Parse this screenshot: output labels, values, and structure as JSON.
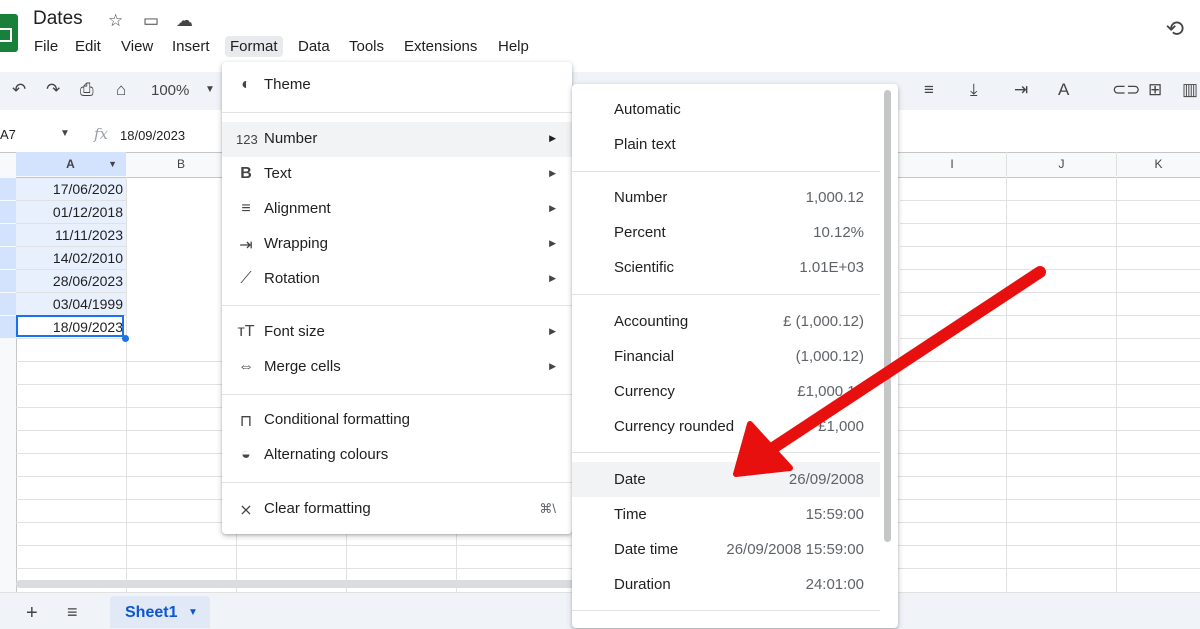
{
  "app": {
    "doc_title": "Dates",
    "menus": [
      "File",
      "Edit",
      "View",
      "Insert",
      "Format",
      "Data",
      "Tools",
      "Extensions",
      "Help"
    ]
  },
  "toolbar": {
    "zoom": "100%"
  },
  "formula_bar": {
    "cell_ref": "A7",
    "value": "18/09/2023"
  },
  "grid": {
    "columns": [
      "A",
      "B",
      "I",
      "J",
      "K"
    ],
    "cells_a": [
      "17/06/2020",
      "01/12/2018",
      "11/11/2023",
      "14/02/2010",
      "28/06/2023",
      "03/04/1999",
      "18/09/2023"
    ]
  },
  "sheet_tab": "Sheet1",
  "format_menu": {
    "items": [
      {
        "label": "Theme",
        "icon": "palette-icon"
      },
      {
        "label": "Number",
        "icon": "number-format-icon"
      },
      {
        "label": "Text",
        "icon": "bold-icon"
      },
      {
        "label": "Alignment",
        "icon": "align-icon"
      },
      {
        "label": "Wrapping",
        "icon": "wrap-icon"
      },
      {
        "label": "Rotation",
        "icon": "rotation-icon"
      },
      {
        "label": "Font size",
        "icon": "font-size-icon"
      },
      {
        "label": "Merge cells",
        "icon": "merge-icon"
      },
      {
        "label": "Conditional formatting",
        "icon": "paint-roller-icon"
      },
      {
        "label": "Alternating colours",
        "icon": "fill-drop-icon"
      },
      {
        "label": "Clear formatting",
        "icon": "clear-format-icon",
        "shortcut": "⌘\\"
      }
    ]
  },
  "number_menu": {
    "items": [
      {
        "label": "Automatic",
        "sample": ""
      },
      {
        "label": "Plain text",
        "sample": ""
      },
      {
        "label": "Number",
        "sample": "1,000.12"
      },
      {
        "label": "Percent",
        "sample": "10.12%"
      },
      {
        "label": "Scientific",
        "sample": "1.01E+03"
      },
      {
        "label": "Accounting",
        "sample": "£ (1,000.12)"
      },
      {
        "label": "Financial",
        "sample": "(1,000.12)"
      },
      {
        "label": "Currency",
        "sample": "£1,000.12"
      },
      {
        "label": "Currency rounded",
        "sample": "£1,000"
      },
      {
        "label": "Date",
        "sample": "26/09/2008"
      },
      {
        "label": "Time",
        "sample": "15:59:00"
      },
      {
        "label": "Date time",
        "sample": "26/09/2008 15:59:00"
      },
      {
        "label": "Duration",
        "sample": "24:01:00"
      }
    ]
  },
  "colors": {
    "accent": "#1a73e8",
    "annotation_arrow": "#e8100f",
    "sheets_green": "#188038"
  }
}
